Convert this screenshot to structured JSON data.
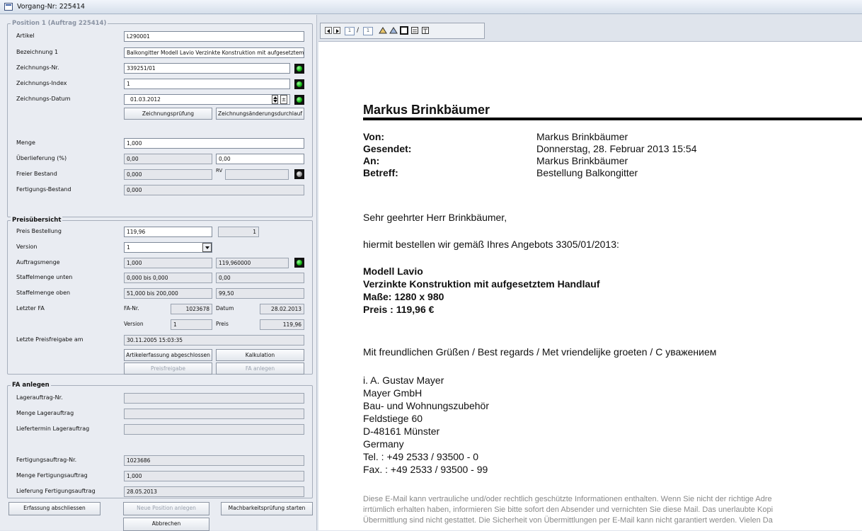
{
  "window": {
    "title": "Vorgang-Nr: 225414"
  },
  "position": {
    "legend": "Position 1 (Auftrag 225414)",
    "artikel_label": "Artikel",
    "artikel": "L290001",
    "bez_label": "Bezeichnung 1",
    "bez": "Balkongitter Modell Lavio Verzinkte Konstruktion mit aufgesetztem Ha",
    "znr_label": "Zeichnungs-Nr.",
    "znr": "339251/01",
    "zidx_label": "Zeichnungs-Index",
    "zidx": "1",
    "zdat_label": "Zeichnungs-Datum",
    "zdat": "01.03.2012",
    "btn_zpruef": "Zeichnungsprüfung",
    "btn_zaend": "Zeichnungsänderungsdurchlauf",
    "menge_label": "Menge",
    "menge": "1,000",
    "ueber_label": "Überlieferung (%)",
    "ueber1": "0,00",
    "ueber2": "0,00",
    "frei_label": "Freier Bestand",
    "frei": "0,000",
    "rv_label": "RV",
    "rv": "",
    "fert_label": "Fertigungs-Bestand",
    "fert": "0,000"
  },
  "preis": {
    "legend": "Preisübersicht",
    "pb_label": "Preis Bestellung",
    "pb": "119,96",
    "pb2": "1",
    "ver_label": "Version",
    "ver": "1",
    "am_label": "Auftragsmenge",
    "am1": "1,000",
    "am2": "119,960000",
    "su_label": "Staffelmenge unten",
    "su1": "0,000 bis 0,000",
    "su2": "0,00",
    "so_label": "Staffelmenge oben",
    "so1": "51,000 bis 200,000",
    "so2": "99,50",
    "lfa_label": "Letzter FA",
    "fanr_label": "FA-Nr.",
    "fanr": "1023678",
    "datum_label": "Datum",
    "datum": "28.02.2013",
    "fver_label": "Version",
    "fver": "1",
    "fpreis_label": "Preis",
    "fpreis": "119,96",
    "lpf_label": "Letzte Preisfreigabe am",
    "lpf": "30.11.2005 15:03:35",
    "btn_abgeschl": "Artikelerfassung abgeschlossen",
    "btn_kalk": "Kalkulation",
    "btn_preisfrei": "Preisfreigabe",
    "btn_fa": "FA anlegen"
  },
  "fa": {
    "legend": "FA anlegen",
    "lnr_label": "Lagerauftrag-Nr.",
    "lnr": "",
    "lmenge_label": "Menge Lagerauftrag",
    "lmenge": "",
    "lterm_label": "Liefertermin Lagerauftrag",
    "lterm": "",
    "fnr_label": "Fertigungsauftrag-Nr.",
    "fnr": "1023686",
    "fmenge_label": "Menge Fertigungsauftrag",
    "fmenge": "1,000",
    "flief_label": "Lieferung Fertigungsauftrag",
    "flief": "28.05.2013"
  },
  "bottom": {
    "btn_erf": "Erfassung abschliessen",
    "btn_neu": "Neue Position anlegen",
    "btn_mach": "Machbarkeitsprüfung starten",
    "btn_abbr": "Abbrechen"
  },
  "viewer": {
    "page": "1",
    "pages": "1",
    "sep": "/"
  },
  "email": {
    "name": "Markus Brinkbäumer",
    "von_k": "Von:",
    "von_v": "Markus Brinkbäumer",
    "ges_k": "Gesendet:",
    "ges_v": "Donnerstag, 28. Februar 2013 15:54",
    "an_k": "An:",
    "an_v": "Markus Brinkbäumer",
    "betr_k": "Betreff:",
    "betr_v": "Bestellung Balkongitter",
    "greet": "Sehr geehrter Herr Brinkbäumer,",
    "intro": "hiermit bestellen wir gemäß Ihres Angebots 3305/01/2013:",
    "b1": "Modell Lavio",
    "b2": "Verzinkte Konstruktion mit aufgesetztem Handlauf",
    "b3": "Maße: 1280 x 980",
    "b4": "Preis : 119,96 €",
    "closing": "Mit freundlichen Grüßen / Best regards / Met vriendelijke groeten / С уважением",
    "s1": "i. A. Gustav Mayer",
    "s2": "Mayer GmbH",
    "s3": "Bau- und Wohnungszubehör",
    "s4": "Feldstiege 60",
    "s5": "D-48161 Münster",
    "s6": "Germany",
    "s7": "Tel.   : +49 2533 / 93500 - 0",
    "s8": "Fax.  : +49 2533 / 93500 - 99",
    "d1": "Diese E-Mail kann vertrauliche und/oder rechtlich geschützte Informationen enthalten. Wenn Sie nicht der richtige Adre",
    "d2": "irrtümlich erhalten haben, informieren Sie bitte sofort den Absender und vernichten Sie diese Mail. Das unerlaubte Kopi",
    "d3": "Übermittlung sind nicht gestattet. Die Sicherheit von Übermittlungen per E-Mail kann nicht garantiert werden. Vielen Da"
  }
}
